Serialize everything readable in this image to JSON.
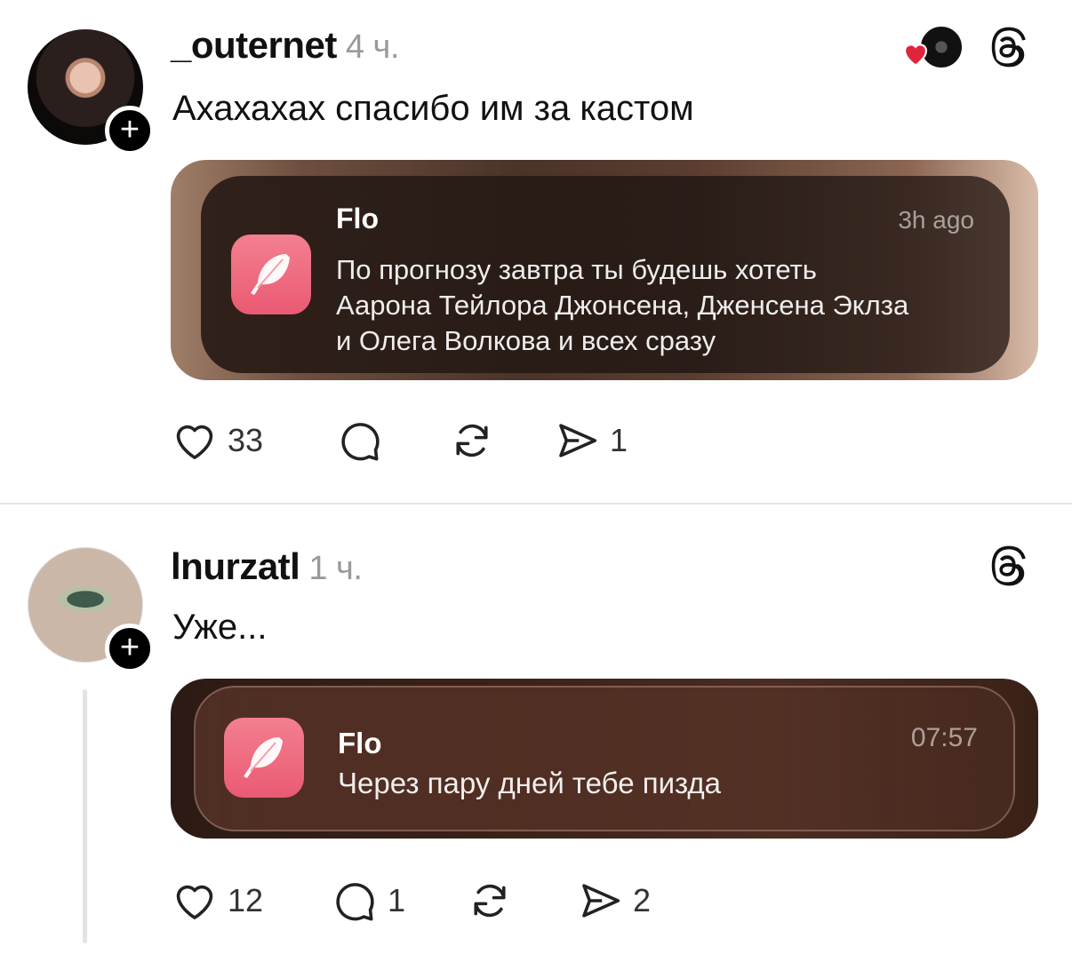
{
  "posts": [
    {
      "username": "_outernet",
      "time": "4 ч.",
      "text": "Ахахахах спасибо им за кастом",
      "notification": {
        "app": "Flo",
        "time": "3h ago",
        "lines": [
          "По прогнозу завтра ты будешь хотеть",
          "Аарона Тейлора Джонсена, Дженсена Эклза",
          "и Олега Волкова и всех сразу"
        ]
      },
      "likes": "33",
      "replies": "",
      "reposts": "",
      "shares": "1"
    },
    {
      "username": "lnurzatl",
      "time": "1 ч.",
      "text": "Уже...",
      "notification": {
        "app": "Flo",
        "time": "07:57",
        "lines": [
          "Через пару дней тебе пизда"
        ]
      },
      "likes": "12",
      "replies": "1",
      "reposts": "",
      "shares": "2"
    }
  ],
  "icons": {
    "follow": "+",
    "threads": "threads-logo-icon",
    "like": "heart-icon",
    "reply": "comment-icon",
    "repost": "repost-icon",
    "share": "send-icon"
  },
  "colors": {
    "app_icon": "#ea5a73",
    "heart_badge": "#e0243b"
  }
}
